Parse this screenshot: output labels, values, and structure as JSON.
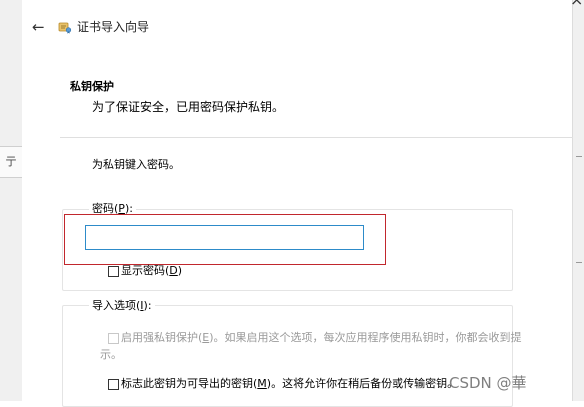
{
  "window": {
    "title": "证书导入向导",
    "close_glyph": "×",
    "back_glyph": "←"
  },
  "background": {
    "left_tab_text": "亍"
  },
  "header": {
    "section_title": "私钥保护",
    "section_description": "为了保证安全，已用密码保护私钥。"
  },
  "main": {
    "instruction": "为私钥键入密码。",
    "password_group": {
      "label_prefix": "密码(",
      "label_key": "P",
      "label_suffix": "):",
      "value": "",
      "show_password": {
        "label_prefix": "显示密码(",
        "label_key": "D",
        "label_suffix": ")",
        "checked": false
      }
    },
    "import_options": {
      "label_prefix": "导入选项(",
      "label_key": "I",
      "label_suffix": "):",
      "strong_protection": {
        "label_prefix": "启用强私钥保护(",
        "label_key": "E",
        "label_suffix": ")。如果启用这个选项，每次应用程序使用私钥时，你都会收到提",
        "label_line2": "示。",
        "checked": false,
        "enabled": false
      },
      "exportable": {
        "label_prefix": "标志此密钥为可导出的密钥(",
        "label_key": "M",
        "label_suffix": ")。这将允许你在稍后备份或传输密钥。",
        "checked": false
      }
    }
  },
  "watermark": "CSDN @華",
  "colors": {
    "highlight_border": "#c1272d",
    "input_focus_border": "#2d8bc9",
    "disabled_text": "#9a9a9a"
  }
}
